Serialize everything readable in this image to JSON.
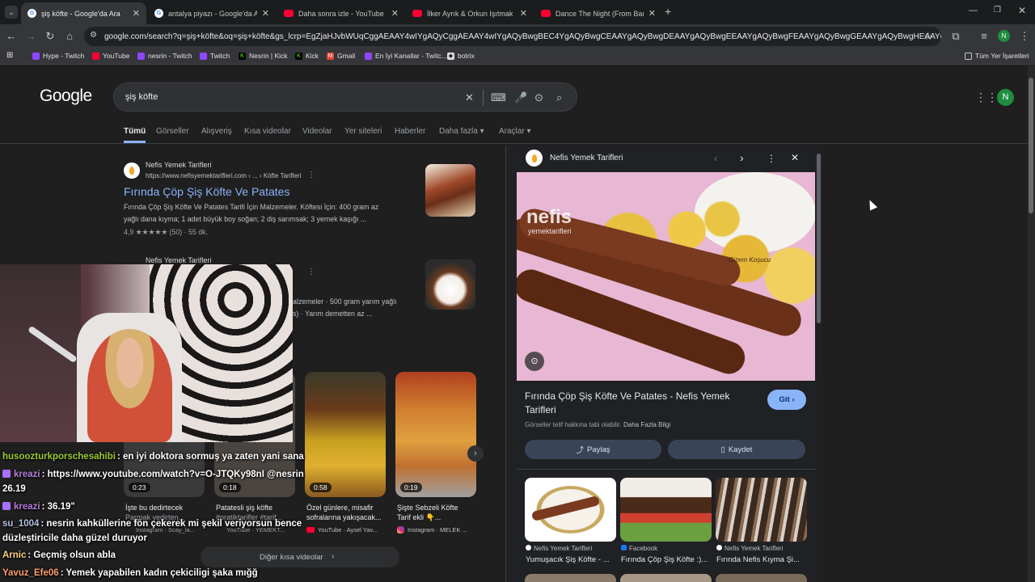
{
  "tabs": [
    {
      "title": "şiş köfte - Google'da Ara",
      "favicon": "google-icon",
      "active": true
    },
    {
      "title": "antalya piyazı - Google'da Ara",
      "favicon": "google-icon",
      "active": false
    },
    {
      "title": "Daha sonra izle - YouTube",
      "favicon": "youtube-icon",
      "active": false
    },
    {
      "title": "İlker Ayrık & Orkun Işıtmak ile İ",
      "favicon": "youtube-icon",
      "active": false
    },
    {
      "title": "Dance The Night (From Barbie",
      "favicon": "youtube-icon",
      "active": false
    }
  ],
  "new_tab": "+",
  "url": "google.com/search?q=şiş+köfte&oq=şiş+köfte&gs_lcrp=EgZjaHJvbWUqCggAEAAY4wIYgAQyCggAEAAY4wIYgAQyBwgBEC4YgAQyBwgCEAAYgAQyBwgDEAAYgAQyBwgEEAAYgAQyBwgFEAAYgAQyBwgGEAAYgAQyBwgHEAAYgAQyBwgIEAAYgA...",
  "bookmarks": [
    {
      "label": "Hype - Twitch",
      "icon": "twitch-icon"
    },
    {
      "label": "YouTube",
      "icon": "youtube-icon"
    },
    {
      "label": "nesrin - Twitch",
      "icon": "twitch-icon"
    },
    {
      "label": "Twitch",
      "icon": "twitch-icon"
    },
    {
      "label": "Nesrin | Kick",
      "icon": "kick-icon"
    },
    {
      "label": "Kick",
      "icon": "kick-icon"
    },
    {
      "label": "Gmail",
      "icon": "gmail-icon"
    },
    {
      "label": "En İyi Kanallar - Twitc...",
      "icon": "twitch-icon"
    },
    {
      "label": "botrix",
      "icon": "botrix-icon"
    }
  ],
  "all_bookmarks": "Tüm Yer İşaretleri",
  "google": {
    "logo": "Google",
    "query": "şiş köfte",
    "avatar": "N",
    "nav_tabs": [
      "Tümü",
      "Görseller",
      "Alışveriş",
      "Kısa videolar",
      "Videolar",
      "Yer siteleri",
      "Haberler",
      "Daha fazla ▾",
      "Araçlar ▾"
    ]
  },
  "results": [
    {
      "source": "Nefis Yemek Tarifleri",
      "url": "https://www.nefisyemektarifleri.com › ... › Köfte Tarifleri",
      "title": "Fırında Çöp Şiş Köfte Ve Patates",
      "snippet1": "Fırında Çöp Şiş Köfte Ve Patates Tarifi İçin Malzemeler. Köftesi İçin: 400 gram az",
      "snippet2": "yağlı dana kıyma; 1 adet büyük boy soğan; 2 diş sarımsak; 3 yemek kaşığı ...",
      "rating": "4,9 ★★★★★ (50) · 55 dk."
    },
    {
      "source": "Nefis Yemek Tarifleri",
      "snippet1": "alzemeler · 500 gram yarım yağlı",
      "snippet2": "s) · Yarım demetten az ..."
    }
  ],
  "chat": [
    {
      "user": "husoozturkporschesahibi",
      "color": "#9acd32",
      "msg": ": en iyi doktora sormuş ya zaten yani sana"
    },
    {
      "user": "kreazi",
      "color": "#b57edc",
      "msg": ": https://www.youtube.com/watch?v=O-JTQKy98nI @nesrin"
    },
    {
      "user": "",
      "color": "#fff",
      "msg": "26.19"
    },
    {
      "user": "kreazi",
      "color": "#b57edc",
      "msg": ": 36.19\""
    },
    {
      "user": "su_1004",
      "color": "#b0c4de",
      "msg": ": nesrin kahküllerine fön çekerek mi şekil veriyorsun bence"
    },
    {
      "user": "",
      "color": "#fff",
      "msg": "düzleştiricile daha güzel duruyor"
    },
    {
      "user": "Arnic",
      "color": "#ffd27f",
      "msg": ": Geçmiş olsun abla"
    },
    {
      "user": "Yavuz_Efe06",
      "color": "#ff9f6b",
      "msg": ": Yemek yapabilen kadın çekiciligi şaka mığğ"
    }
  ],
  "videos": [
    {
      "duration": "0:23",
      "title": "İşte bu dedirtecek",
      "title2": "Parmak yedirten...",
      "source": "Instagram · Scay_la..."
    },
    {
      "duration": "0:18",
      "title": "Patatesli şiş köfte",
      "title2": "#pratiktarifler #tarif...",
      "source": "YouTube · YEMEKT..."
    },
    {
      "duration": "0:58",
      "title": "Özel günlere, misafir",
      "title2": "sofralarına yakışacak...",
      "source": "YouTube · Aysel Yav..."
    },
    {
      "duration": "0:19",
      "title": "Şişte Sebzeli Köfte",
      "title2": "Tarif ekli 👇...",
      "source": "Instagram · MELEK ..."
    }
  ],
  "more_shorts": "Diğer kısa videolar",
  "panel": {
    "source": "Nefis Yemek Tarifleri",
    "image_watermark": "nefis",
    "image_watermark2": "yemektarifleri",
    "image_signature": "Gizem Koşucu",
    "title": "Fırında Çöp Şiş Köfte Ve Patates - Nefis Yemek Tarifleri",
    "go": "Git ›",
    "copyright": "Görseller telif hakkına tabi olabilir.",
    "more_info": "Daha Fazla Bilgi",
    "share": "Paylaş",
    "save": "Kaydet",
    "related": [
      {
        "source": "Nefis Yemek Tarifleri",
        "title": "Yumuşacık Şiş Köfte - ..."
      },
      {
        "source": "Facebook",
        "title": "Fırında Çöp Şiş Köfte :)..."
      },
      {
        "source": "Nefis Yemek Tarifleri",
        "title": "Fırında Nefis Kıyma Şi..."
      }
    ]
  }
}
